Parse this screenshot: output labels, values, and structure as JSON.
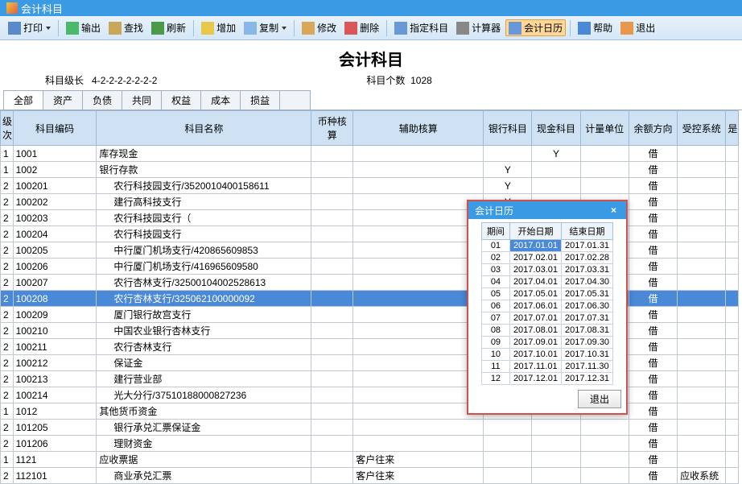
{
  "window_title": "会计科目",
  "toolbar": [
    {
      "label": "打印",
      "icon": "#5a8acc",
      "dropdown": true
    },
    {
      "label": "输出",
      "icon": "#4aba6a"
    },
    {
      "label": "查找",
      "icon": "#c8a858"
    },
    {
      "label": "刷新",
      "icon": "#4a9a4a"
    },
    {
      "label": "增加",
      "icon": "#e8c848"
    },
    {
      "label": "复制",
      "icon": "#88b8e8",
      "dropdown": true
    },
    {
      "label": "修改",
      "icon": "#d8a858"
    },
    {
      "label": "删除",
      "icon": "#d85858"
    },
    {
      "label": "指定科目",
      "icon": "#6898d8"
    },
    {
      "label": "计算器",
      "icon": "#888"
    },
    {
      "label": "会计日历",
      "icon": "#6898d8",
      "active": true
    },
    {
      "label": "帮助",
      "icon": "#4a88d8"
    },
    {
      "label": "退出",
      "icon": "#e89848"
    }
  ],
  "page_title": "会计科目",
  "meta": {
    "level_label": "科目级长",
    "level_value": "4-2-2-2-2-2-2-2",
    "count_label": "科目个数",
    "count_value": "1028"
  },
  "tabs": [
    "全部",
    "资产",
    "负债",
    "共同",
    "权益",
    "成本",
    "损益",
    ""
  ],
  "columns": [
    "级次",
    "科目编码",
    "科目名称",
    "币种核算",
    "辅助核算",
    "银行科目",
    "现金科目",
    "计量单位",
    "余额方向",
    "受控系统",
    "是"
  ],
  "rows": [
    {
      "lv": "1",
      "code": "1001",
      "name": "库存现金",
      "cash": "Y",
      "dir": "借"
    },
    {
      "lv": "1",
      "code": "1002",
      "name": "银行存款",
      "bank": "Y",
      "dir": "借"
    },
    {
      "lv": "2",
      "code": "100201",
      "name": "农行科技园支行/3520010400158611",
      "indent": 1,
      "bank": "Y",
      "dir": "借"
    },
    {
      "lv": "2",
      "code": "100202",
      "name": "建行高科技支行",
      "indent": 1,
      "bank": "Y",
      "dir": "借"
    },
    {
      "lv": "2",
      "code": "100203",
      "name": "农行科技园支行（",
      "indent": 1,
      "dir": "借"
    },
    {
      "lv": "2",
      "code": "100204",
      "name": "农行科技园支行",
      "indent": 1,
      "dir": "借"
    },
    {
      "lv": "2",
      "code": "100205",
      "name": "中行厦门机场支行/420865609853",
      "indent": 1,
      "dir": "借"
    },
    {
      "lv": "2",
      "code": "100206",
      "name": "中行厦门机场支行/416965609580",
      "indent": 1,
      "dir": "借"
    },
    {
      "lv": "2",
      "code": "100207",
      "name": "农行杏林支行/32500104002528613",
      "indent": 1,
      "dir": "借"
    },
    {
      "lv": "2",
      "code": "100208",
      "name": "农行杏林支行/325062100000092",
      "indent": 1,
      "dir": "借",
      "selected": true
    },
    {
      "lv": "2",
      "code": "100209",
      "name": "厦门银行故宫支行",
      "indent": 1,
      "dir": "借"
    },
    {
      "lv": "2",
      "code": "100210",
      "name": "中国农业银行杏林支行",
      "indent": 1,
      "dir": "借"
    },
    {
      "lv": "2",
      "code": "100211",
      "name": "农行杏林支行",
      "indent": 1,
      "dir": "借"
    },
    {
      "lv": "2",
      "code": "100212",
      "name": "保证金",
      "indent": 1,
      "dir": "借"
    },
    {
      "lv": "2",
      "code": "100213",
      "name": "建行营业部",
      "indent": 1,
      "dir": "借"
    },
    {
      "lv": "2",
      "code": "100214",
      "name": "光大分行/37510188000827236",
      "indent": 1,
      "dir": "借"
    },
    {
      "lv": "1",
      "code": "1012",
      "name": "其他货币资金",
      "dir": "借"
    },
    {
      "lv": "2",
      "code": "101205",
      "name": "银行承兑汇票保证金",
      "indent": 1,
      "dir": "借"
    },
    {
      "lv": "2",
      "code": "101206",
      "name": "理财资金",
      "indent": 1,
      "dir": "借"
    },
    {
      "lv": "1",
      "code": "1121",
      "name": "应收票据",
      "aux": "客户往来",
      "dir": "借"
    },
    {
      "lv": "2",
      "code": "112101",
      "name": "商业承兑汇票",
      "indent": 1,
      "aux": "客户往来",
      "dir": "借",
      "sys": "应收系统"
    }
  ],
  "modal": {
    "title": "会计日历",
    "headers": [
      "期间",
      "开始日期",
      "结束日期"
    ],
    "rows": [
      {
        "p": "01",
        "s": "2017.01.01",
        "e": "2017.01.31",
        "sel": true
      },
      {
        "p": "02",
        "s": "2017.02.01",
        "e": "2017.02.28"
      },
      {
        "p": "03",
        "s": "2017.03.01",
        "e": "2017.03.31"
      },
      {
        "p": "04",
        "s": "2017.04.01",
        "e": "2017.04.30"
      },
      {
        "p": "05",
        "s": "2017.05.01",
        "e": "2017.05.31"
      },
      {
        "p": "06",
        "s": "2017.06.01",
        "e": "2017.06.30"
      },
      {
        "p": "07",
        "s": "2017.07.01",
        "e": "2017.07.31"
      },
      {
        "p": "08",
        "s": "2017.08.01",
        "e": "2017.08.31"
      },
      {
        "p": "09",
        "s": "2017.09.01",
        "e": "2017.09.30"
      },
      {
        "p": "10",
        "s": "2017.10.01",
        "e": "2017.10.31"
      },
      {
        "p": "11",
        "s": "2017.11.01",
        "e": "2017.11.30"
      },
      {
        "p": "12",
        "s": "2017.12.01",
        "e": "2017.12.31"
      }
    ],
    "exit_label": "退出"
  }
}
